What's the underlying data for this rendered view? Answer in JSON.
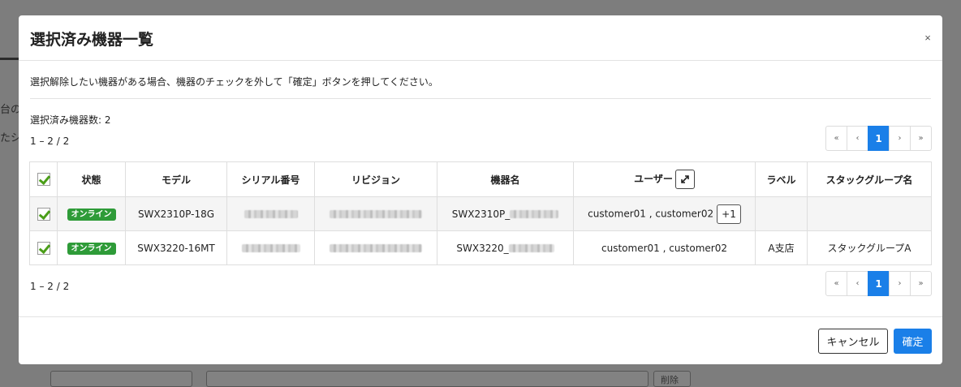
{
  "background": {
    "text_1": "台の",
    "text_2": "たシ",
    "label_fragment": "削除"
  },
  "modal": {
    "title": "選択済み機器一覧",
    "close_label": "×",
    "instruction": "選択解除したい機器がある場合、機器のチェックを外して「確定」ボタンを押してください。",
    "selected_count": "選択済み機器数: 2",
    "range_top": "1 – 2 / 2",
    "range_bottom": "1 – 2 / 2",
    "pagination": {
      "first": "«",
      "prev": "‹",
      "current": "1",
      "next": "›",
      "last": "»"
    },
    "table": {
      "headers": {
        "status": "状態",
        "model": "モデル",
        "serial": "シリアル番号",
        "revision": "リビジョン",
        "device_name": "機器名",
        "user": "ユーザー",
        "label": "ラベル",
        "stack_group": "スタックグループ名"
      },
      "rows": [
        {
          "checked": true,
          "status": "オンライン",
          "model": "SWX2310P-18G",
          "device_name_prefix": "SWX2310P_",
          "users": "customer01 , customer02",
          "more_users": "+1",
          "label": "",
          "stack_group": ""
        },
        {
          "checked": true,
          "status": "オンライン",
          "model": "SWX3220-16MT",
          "device_name_prefix": "SWX3220_",
          "users": "customer01 , customer02",
          "label": "A支店",
          "stack_group": "スタックグループA"
        }
      ]
    },
    "buttons": {
      "cancel": "キャンセル",
      "confirm": "確定"
    }
  },
  "colors": {
    "overlay": "#7d7d7d",
    "primary": "#1a7fe8",
    "online_badge": "#2e9b38",
    "check": "#4a9e18"
  }
}
